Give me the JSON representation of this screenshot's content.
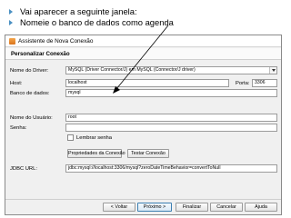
{
  "slide": {
    "bullets": [
      "Vai aparecer a seguinte janela:",
      "Nomeie o banco de dados como agenda"
    ]
  },
  "dialog": {
    "title": "Assistente de Nova Conexão",
    "section_title": "Personalizar Conexão",
    "driver_label": "Nome do Driver:",
    "driver_value": "MySQL (Driver Connector/J) em MySQL (Connector/J driver)",
    "host_label": "Host:",
    "host_value": "localhost",
    "port_label": "Porta:",
    "port_value": "3306",
    "database_label": "Banco de dados:",
    "database_value": "mysql",
    "user_label": "Nome do Usuário:",
    "user_value": "root",
    "password_label": "Senha:",
    "password_value": "",
    "remember_password_label": "Lembrar senha",
    "remember_password_checked": false,
    "properties_button": "Propriedades da Conexão",
    "test_button": "Testar Conexão",
    "jdbc_label": "JDBC URL:",
    "jdbc_value": "jdbc:mysql://localhost:3306/mysql?zeroDateTimeBehavior=convertToNull",
    "back_button": "< Voltar",
    "next_button": "Próximo >",
    "finish_button": "Finalizar",
    "cancel_button": "Cancelar",
    "help_button": "Ajuda"
  },
  "colors": {
    "bullet": "#4a90c2",
    "default_button_border": "#3c7fb1",
    "pointer": "#000000"
  },
  "icons": {
    "bullet": "arrow-bullet-icon",
    "window": "netbeans-window-icon",
    "combo": "chevron-down-icon"
  }
}
